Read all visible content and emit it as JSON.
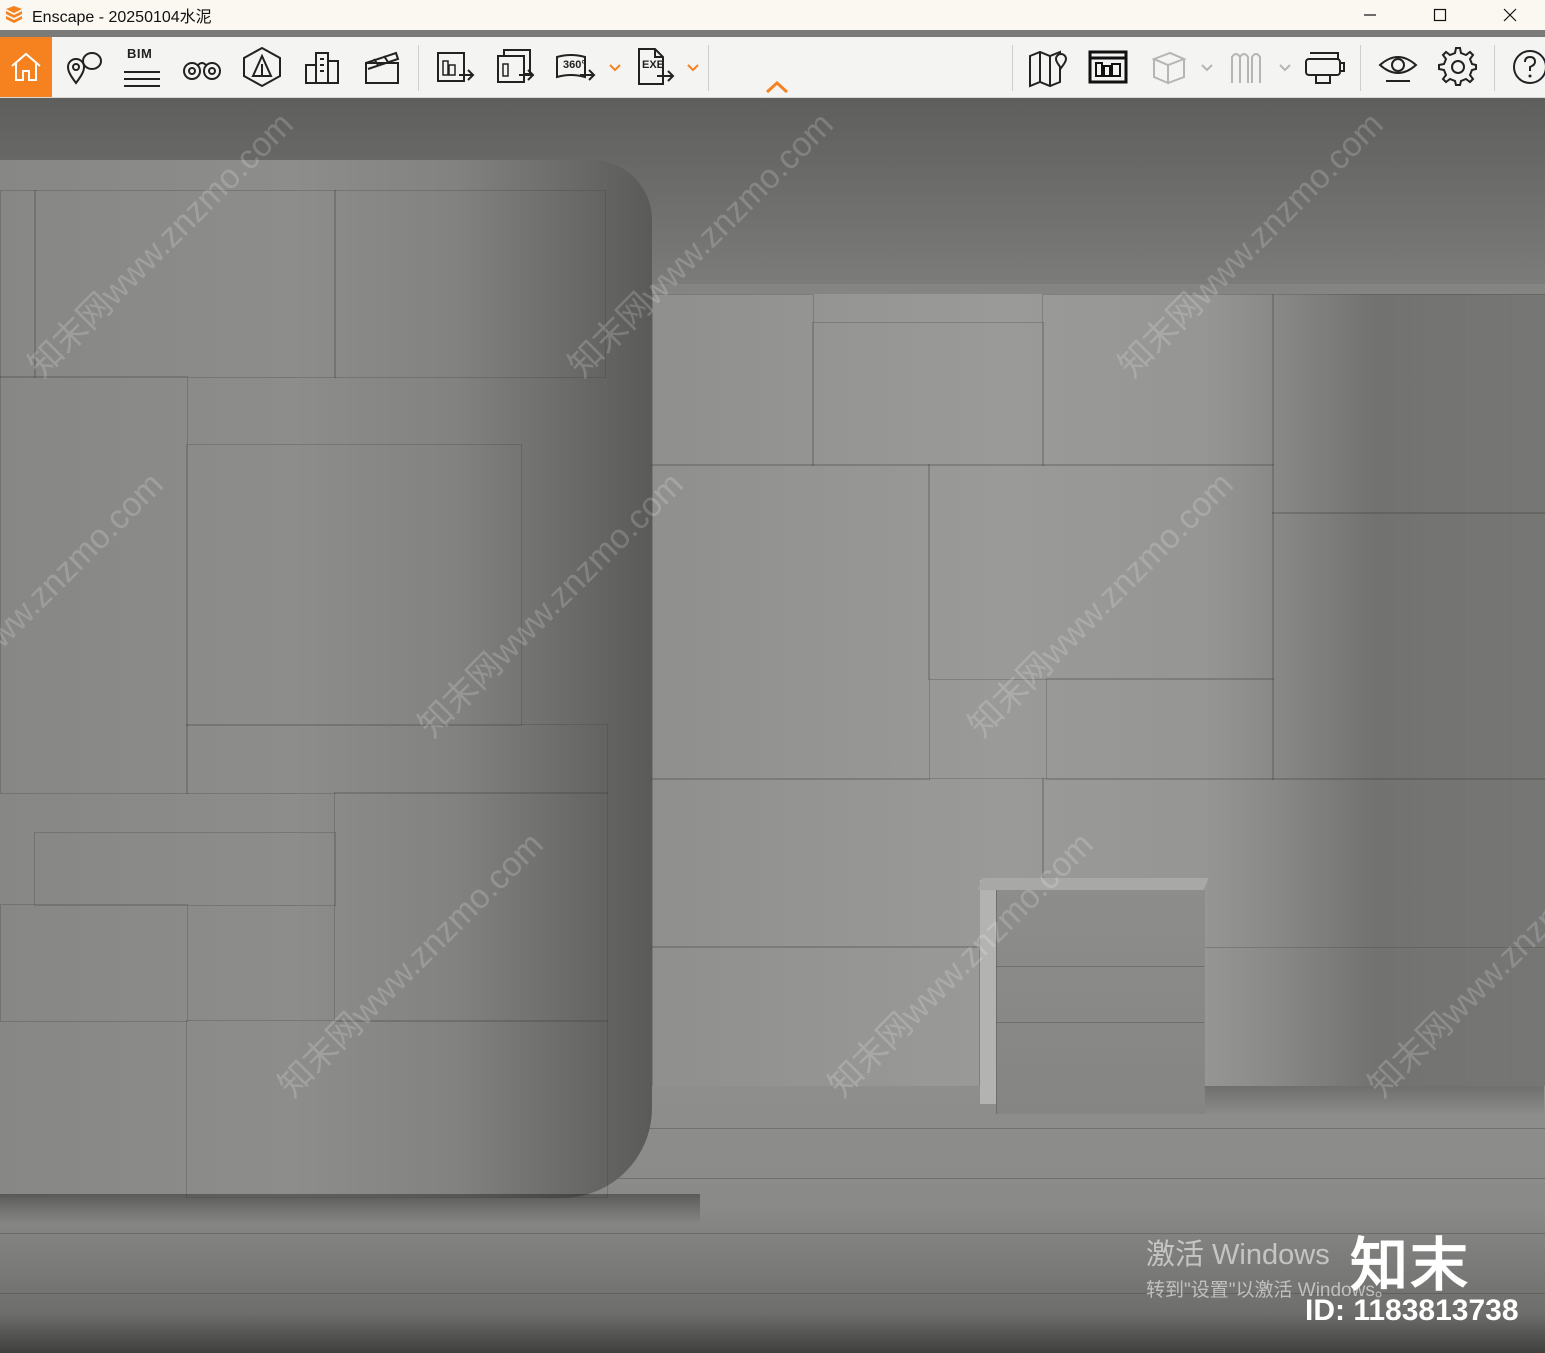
{
  "window": {
    "title": "Enscape - 20250104水泥",
    "controls": [
      "minimize-icon",
      "maximize-icon",
      "close-icon"
    ]
  },
  "toolbar": {
    "bim_label": "BIM",
    "panorama_label": "360°",
    "exe_label": "EXE",
    "left_tools": [
      "home-icon",
      "location-pins-icon",
      "bim-icon",
      "binoculars-icon",
      "perspective-icon",
      "buildings-icon",
      "clapperboard-icon"
    ],
    "export_tools": [
      "render-export-icon",
      "batch-render-icon",
      "panorama-360-icon",
      "exe-export-icon"
    ],
    "right_tools": [
      "map-icon",
      "asset-library-icon",
      "cube-view-icon",
      "visual-presets-icon",
      "vr-headset-icon",
      "eye-icon",
      "settings-icon",
      "help-icon"
    ],
    "accent_color": "#f5821f"
  },
  "scene": {
    "watermark_text": "知末网www.znzmo.com",
    "activation_line1": "激活 Windows",
    "activation_line2": "转到\"设置\"以激活 Windows。",
    "brand_text": "知末",
    "id_text": "ID: 1183813738"
  }
}
